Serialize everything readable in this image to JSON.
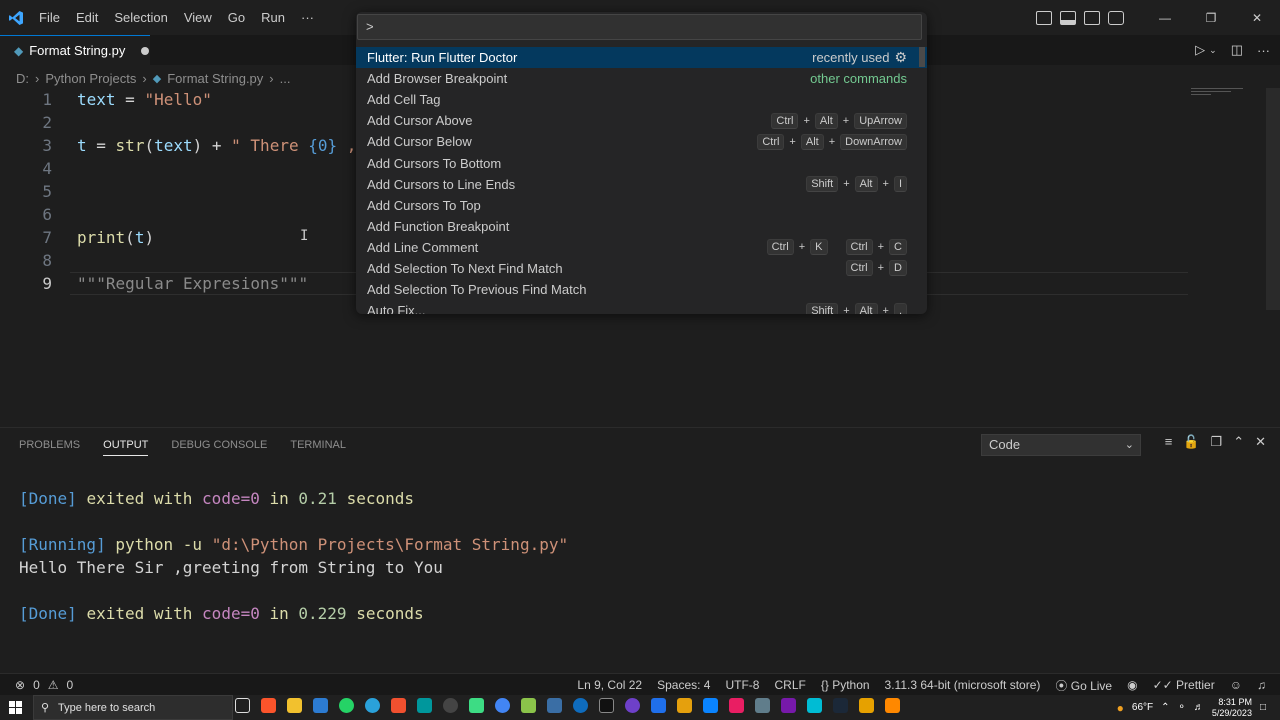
{
  "menu": {
    "items": [
      "File",
      "Edit",
      "Selection",
      "View",
      "Go",
      "Run",
      "···"
    ]
  },
  "tab": {
    "label": "Format String.py"
  },
  "breadcrumb": {
    "drive": "D:",
    "sep": "›",
    "folder": "Python Projects",
    "file": "Format String.py",
    "more": "..."
  },
  "editor": {
    "line_numbers": [
      "1",
      "2",
      "3",
      "4",
      "5",
      "6",
      "7",
      "8",
      "9"
    ]
  },
  "command_palette": {
    "input_value": ">",
    "items": [
      {
        "label": "Flutter: Run Flutter Doctor",
        "tag": "recently used"
      },
      {
        "label": "Add Browser Breakpoint",
        "tag": "other commands"
      },
      {
        "label": "Add Cell Tag"
      },
      {
        "label": "Add Cursor Above",
        "keys": [
          "Ctrl",
          "Alt",
          "UpArrow"
        ]
      },
      {
        "label": "Add Cursor Below",
        "keys": [
          "Ctrl",
          "Alt",
          "DownArrow"
        ]
      },
      {
        "label": "Add Cursors To Bottom"
      },
      {
        "label": "Add Cursors to Line Ends",
        "keys": [
          "Shift",
          "Alt",
          "I"
        ]
      },
      {
        "label": "Add Cursors To Top"
      },
      {
        "label": "Add Function Breakpoint"
      },
      {
        "label": "Add Line Comment",
        "keys": [
          "Ctrl",
          "K"
        ],
        "keys2": [
          "Ctrl",
          "C"
        ]
      },
      {
        "label": "Add Selection To Next Find Match",
        "keys": [
          "Ctrl",
          "D"
        ]
      },
      {
        "label": "Add Selection To Previous Find Match"
      },
      {
        "label": "Auto Fix...",
        "keys": [
          "Shift",
          "Alt",
          "."
        ]
      }
    ]
  },
  "panel": {
    "tabs": [
      "PROBLEMS",
      "OUTPUT",
      "DEBUG CONSOLE",
      "TERMINAL"
    ],
    "active_tab": "OUTPUT",
    "channel": "Code",
    "output": {
      "done1_tag": "[Done]",
      "exited": "exited with",
      "code_eq": "code=0",
      "in": "in",
      "time1": "0.21",
      "seconds": "seconds",
      "running_tag": "[Running]",
      "command": "python -u",
      "path": "\"d:\\Python Projects\\Format String.py\"",
      "result": "Hello There Sir ,greeting from String to You",
      "done2_tag": "[Done]",
      "time2": "0.229"
    }
  },
  "statusbar": {
    "errors": "0",
    "warnings": "0",
    "position": "Ln 9, Col 22",
    "spaces": "Spaces: 4",
    "encoding": "UTF-8",
    "eol": "CRLF",
    "language": "Python",
    "interpreter": "3.11.3 64-bit (microsoft store)",
    "go_live": "Go Live",
    "prettier": "Prettier"
  },
  "taskbar": {
    "search_placeholder": "Type here to search",
    "weather": "66°F",
    "time": "8:31 PM",
    "date": "5/29/2023"
  },
  "colors": {
    "accent": "#0078d4",
    "selection": "#04395e",
    "string": "#ce9178",
    "variable": "#9cdcfe",
    "function": "#dcdcaa"
  }
}
